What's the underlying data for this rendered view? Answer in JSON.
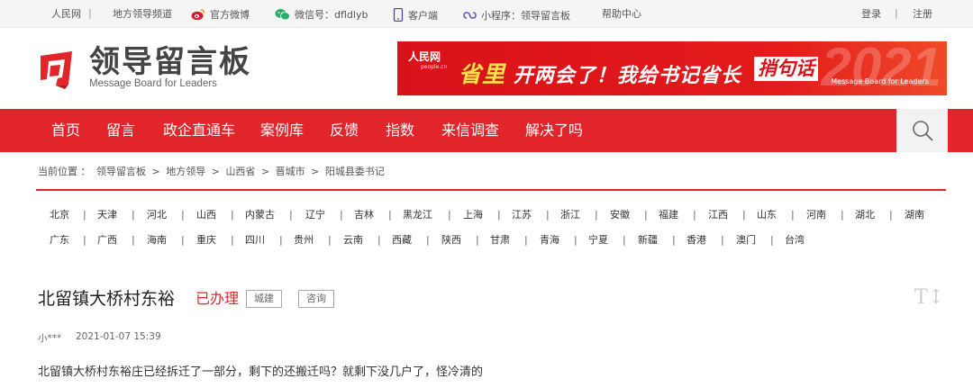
{
  "topbar": {
    "left": [
      "人民网",
      "地方领导频道",
      "官方微博",
      "微信号：dfldlyb",
      "客户端",
      "小程序：领导留言板",
      "帮助中心"
    ],
    "login": "登录",
    "register": "注册",
    "sep": "|"
  },
  "header": {
    "logo_title": "领导留言板",
    "logo_sub": "Message Board for Leaders",
    "banner": {
      "brand": "人民网",
      "brand_sub": "people.cn",
      "highlight": "省里",
      "text": "开两会了！我给书记省长",
      "slogan": "捎句话",
      "year": "2021",
      "sub": "Message Board for Leaders"
    }
  },
  "nav": {
    "items": [
      "首页",
      "留言",
      "政企直通车",
      "案例库",
      "反馈",
      "指数",
      "来信调查",
      "解决了吗"
    ]
  },
  "breadcrumb": {
    "prefix": "当前位置 ：",
    "items": [
      "领导留言板",
      "地方领导",
      "山西省",
      "晋城市",
      "阳城县委书记"
    ],
    "sep": ">"
  },
  "provinces": {
    "row1": [
      "北京",
      "天津",
      "河北",
      "山西",
      "内蒙古",
      "辽宁",
      "吉林",
      "黑龙江",
      "上海",
      "江苏",
      "浙江",
      "安徽",
      "福建",
      "江西",
      "山东",
      "河南",
      "湖北",
      "湖南"
    ],
    "row2": [
      "广东",
      "广西",
      "海南",
      "重庆",
      "四川",
      "贵州",
      "云南",
      "西藏",
      "陕西",
      "甘肃",
      "青海",
      "宁夏",
      "新疆",
      "香港",
      "澳门",
      "台湾"
    ],
    "sep": "|"
  },
  "article": {
    "title": "北留镇大桥村东裕",
    "status": "已办理",
    "tags": [
      "城建",
      "咨询"
    ],
    "font_toggle": "T↕",
    "author": "小***",
    "date": "2021-01-07 15:39",
    "content": "北留镇大桥村东裕庄已经拆迁了一部分，剩下的还搬迁吗？就剩下没几户了，怪冷清的"
  },
  "colors": {
    "accent": "#e2242b",
    "topbar_bg": "#f5f5f5"
  }
}
